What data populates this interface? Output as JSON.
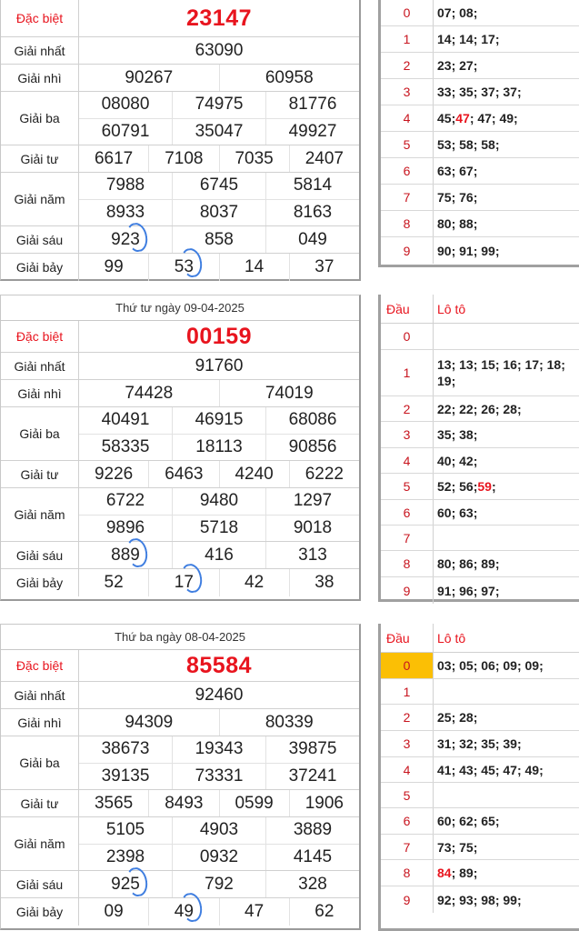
{
  "labels": {
    "db": "Đặc biệt",
    "g1": "Giải nhất",
    "g2": "Giải nhì",
    "g3": "Giải ba",
    "g4": "Giải tư",
    "g5": "Giải năm",
    "g6": "Giải sáu",
    "g7": "Giải bảy",
    "dau": "Đầu",
    "loto": "Lô tô"
  },
  "day1": {
    "title": "",
    "db": "23147",
    "g1": "63090",
    "g2": [
      "90267",
      "60958"
    ],
    "g3": [
      "08080",
      "74975",
      "81776",
      "60791",
      "35047",
      "49927"
    ],
    "g4": [
      "6617",
      "7108",
      "7035",
      "2407"
    ],
    "g5": [
      "7988",
      "6745",
      "5814",
      "8933",
      "8037",
      "8163"
    ],
    "g6": [
      "923",
      "858",
      "049"
    ],
    "g7": [
      "99",
      "53",
      "14",
      "37"
    ],
    "loto": [
      {
        "d": "0",
        "pre": "07; 08;",
        "red": "",
        "post": ""
      },
      {
        "d": "1",
        "pre": "14; 14; 17;",
        "red": "",
        "post": ""
      },
      {
        "d": "2",
        "pre": "23; 27;",
        "red": "",
        "post": ""
      },
      {
        "d": "3",
        "pre": "33; 35; 37; 37;",
        "red": "",
        "post": ""
      },
      {
        "d": "4",
        "pre": "45; ",
        "red": "47",
        "post": "; 47; 49;"
      },
      {
        "d": "5",
        "pre": "53; 58; 58;",
        "red": "",
        "post": ""
      },
      {
        "d": "6",
        "pre": "63; 67;",
        "red": "",
        "post": ""
      },
      {
        "d": "7",
        "pre": "75; 76;",
        "red": "",
        "post": ""
      },
      {
        "d": "8",
        "pre": "80; 88;",
        "red": "",
        "post": ""
      },
      {
        "d": "9",
        "pre": "90; 91; 99;",
        "red": "",
        "post": ""
      }
    ]
  },
  "day2": {
    "title": "Thứ tư ngày 09-04-2025",
    "db": "00159",
    "g1": "91760",
    "g2": [
      "74428",
      "74019"
    ],
    "g3": [
      "40491",
      "46915",
      "68086",
      "58335",
      "18113",
      "90856"
    ],
    "g4": [
      "9226",
      "6463",
      "4240",
      "6222"
    ],
    "g5": [
      "6722",
      "9480",
      "1297",
      "9896",
      "5718",
      "9018"
    ],
    "g6": [
      "889",
      "416",
      "313"
    ],
    "g7": [
      "52",
      "17",
      "42",
      "38"
    ],
    "loto": [
      {
        "d": "0",
        "pre": "",
        "red": "",
        "post": ""
      },
      {
        "d": "1",
        "pre": "13; 13; 15; 16; 17; 18; 19;",
        "red": "",
        "post": ""
      },
      {
        "d": "2",
        "pre": "22; 22; 26; 28;",
        "red": "",
        "post": ""
      },
      {
        "d": "3",
        "pre": "35; 38;",
        "red": "",
        "post": ""
      },
      {
        "d": "4",
        "pre": "40; 42;",
        "red": "",
        "post": ""
      },
      {
        "d": "5",
        "pre": "52; 56; ",
        "red": "59",
        "post": ";"
      },
      {
        "d": "6",
        "pre": "60; 63;",
        "red": "",
        "post": ""
      },
      {
        "d": "7",
        "pre": "",
        "red": "",
        "post": ""
      },
      {
        "d": "8",
        "pre": "80; 86; 89;",
        "red": "",
        "post": ""
      },
      {
        "d": "9",
        "pre": "91; 96; 97;",
        "red": "",
        "post": ""
      }
    ]
  },
  "day3": {
    "title": "Thứ ba ngày 08-04-2025",
    "db": "85584",
    "g1": "92460",
    "g2": [
      "94309",
      "80339"
    ],
    "g3": [
      "38673",
      "19343",
      "39875",
      "39135",
      "73331",
      "37241"
    ],
    "g4": [
      "3565",
      "8493",
      "0599",
      "1906"
    ],
    "g5": [
      "5105",
      "4903",
      "3889",
      "2398",
      "0932",
      "4145"
    ],
    "g6": [
      "925",
      "792",
      "328"
    ],
    "g7": [
      "09",
      "49",
      "47",
      "62"
    ],
    "loto": [
      {
        "d": "0",
        "pre": "03; 05; 06; 09; 09;",
        "red": "",
        "post": ""
      },
      {
        "d": "1",
        "pre": "",
        "red": "",
        "post": ""
      },
      {
        "d": "2",
        "pre": "25; 28;",
        "red": "",
        "post": ""
      },
      {
        "d": "3",
        "pre": "31; 32; 35; 39;",
        "red": "",
        "post": ""
      },
      {
        "d": "4",
        "pre": "41; 43; 45; 47; 49;",
        "red": "",
        "post": ""
      },
      {
        "d": "5",
        "pre": "",
        "red": "",
        "post": ""
      },
      {
        "d": "6",
        "pre": "60; 62; 65;",
        "red": "",
        "post": ""
      },
      {
        "d": "7",
        "pre": "73; 75;",
        "red": "",
        "post": ""
      },
      {
        "d": "8",
        "pre": "",
        "red": "84",
        "post": "; 89;"
      },
      {
        "d": "9",
        "pre": "92; 93; 98; 99;",
        "red": "",
        "post": ""
      }
    ]
  }
}
